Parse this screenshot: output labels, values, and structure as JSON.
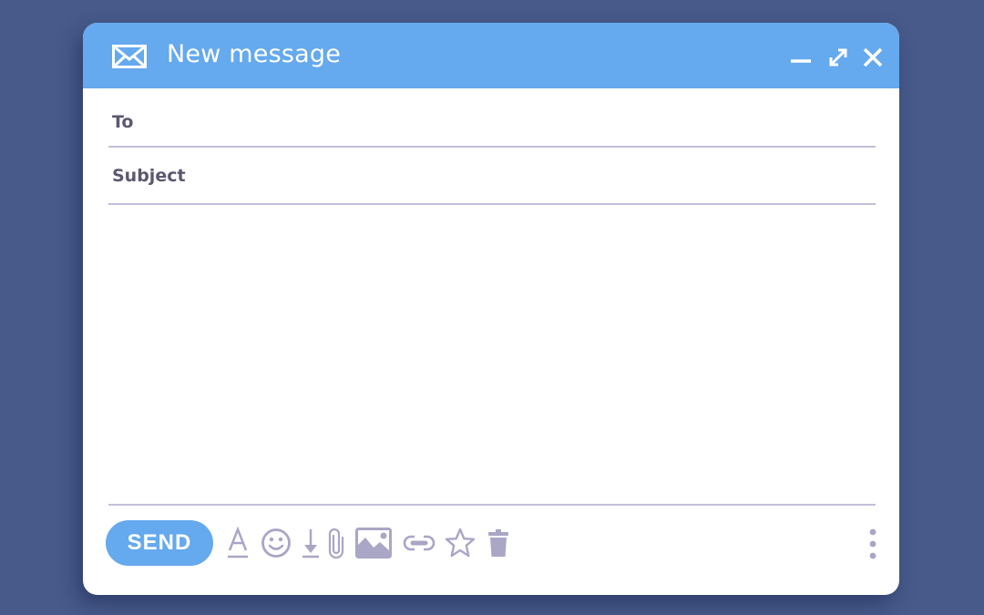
{
  "window": {
    "title": "New message",
    "title_icon": "envelope-icon",
    "controls": [
      {
        "name": "minimize",
        "icon": "minimize-icon"
      },
      {
        "name": "expand",
        "icon": "expand-icon"
      },
      {
        "name": "close",
        "icon": "close-icon"
      }
    ]
  },
  "fields": {
    "to_label": "To",
    "to_value": "",
    "subject_label": "Subject",
    "subject_value": "",
    "body_value": ""
  },
  "toolbar": {
    "send_label": "SEND",
    "tools": [
      "text-format-icon",
      "emoji-icon",
      "download-icon",
      "attachment-icon",
      "image-icon",
      "link-icon",
      "star-icon",
      "trash-icon"
    ],
    "more_icon": "more-vertical-icon"
  },
  "colors": {
    "background": "#475a8a",
    "accent": "#65a9ee",
    "icon": "#a9a6c6",
    "label": "#5b5870",
    "divider": "#c3bfd9"
  }
}
